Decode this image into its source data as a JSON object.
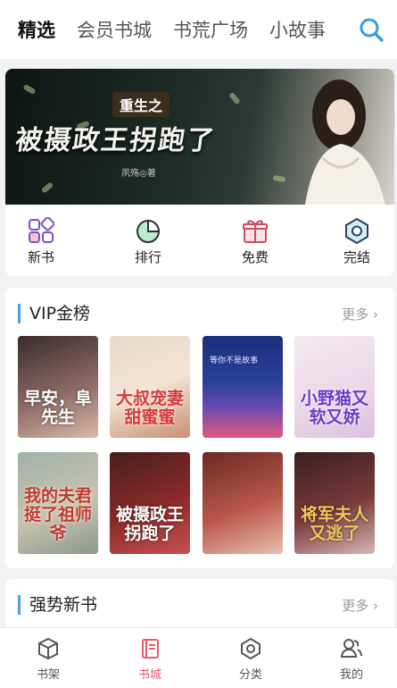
{
  "top_tabs": [
    "精选",
    "会员书城",
    "书荒广场",
    "小故事"
  ],
  "banner": {
    "pre_title": "重生之",
    "title": "被摄政王拐跑了",
    "author": "夙殇◎著"
  },
  "categories": [
    {
      "label": "新书",
      "icon": "grid-icon"
    },
    {
      "label": "排行",
      "icon": "pie-chart-icon"
    },
    {
      "label": "免费",
      "icon": "gift-icon"
    },
    {
      "label": "完结",
      "icon": "hexagon-icon"
    }
  ],
  "vip": {
    "title": "VIP金榜",
    "more": "更多",
    "books": [
      {
        "title": "早安，阜先生"
      },
      {
        "title": "大叔宠妻甜蜜蜜"
      },
      {
        "title": "等你不是故事",
        "small": "等你\n不是故事\n至死"
      },
      {
        "title": "小野猫又软又娇"
      },
      {
        "title": "我的夫君挺了祖师爷"
      },
      {
        "title": "被摄政王拐跑了"
      },
      {
        "title": ""
      },
      {
        "title": "将军夫人又逃了"
      }
    ]
  },
  "new_books": {
    "title": "强势新书",
    "more": "更多"
  },
  "bottom_nav": [
    {
      "label": "书架",
      "icon": "cube-icon"
    },
    {
      "label": "书城",
      "icon": "book-icon"
    },
    {
      "label": "分类",
      "icon": "category-icon"
    },
    {
      "label": "我的",
      "icon": "user-icon"
    }
  ],
  "colors": {
    "accent": "#e85b6b",
    "section_bar": "#4aa0e0",
    "icon_purple": "#7b4fc9"
  }
}
